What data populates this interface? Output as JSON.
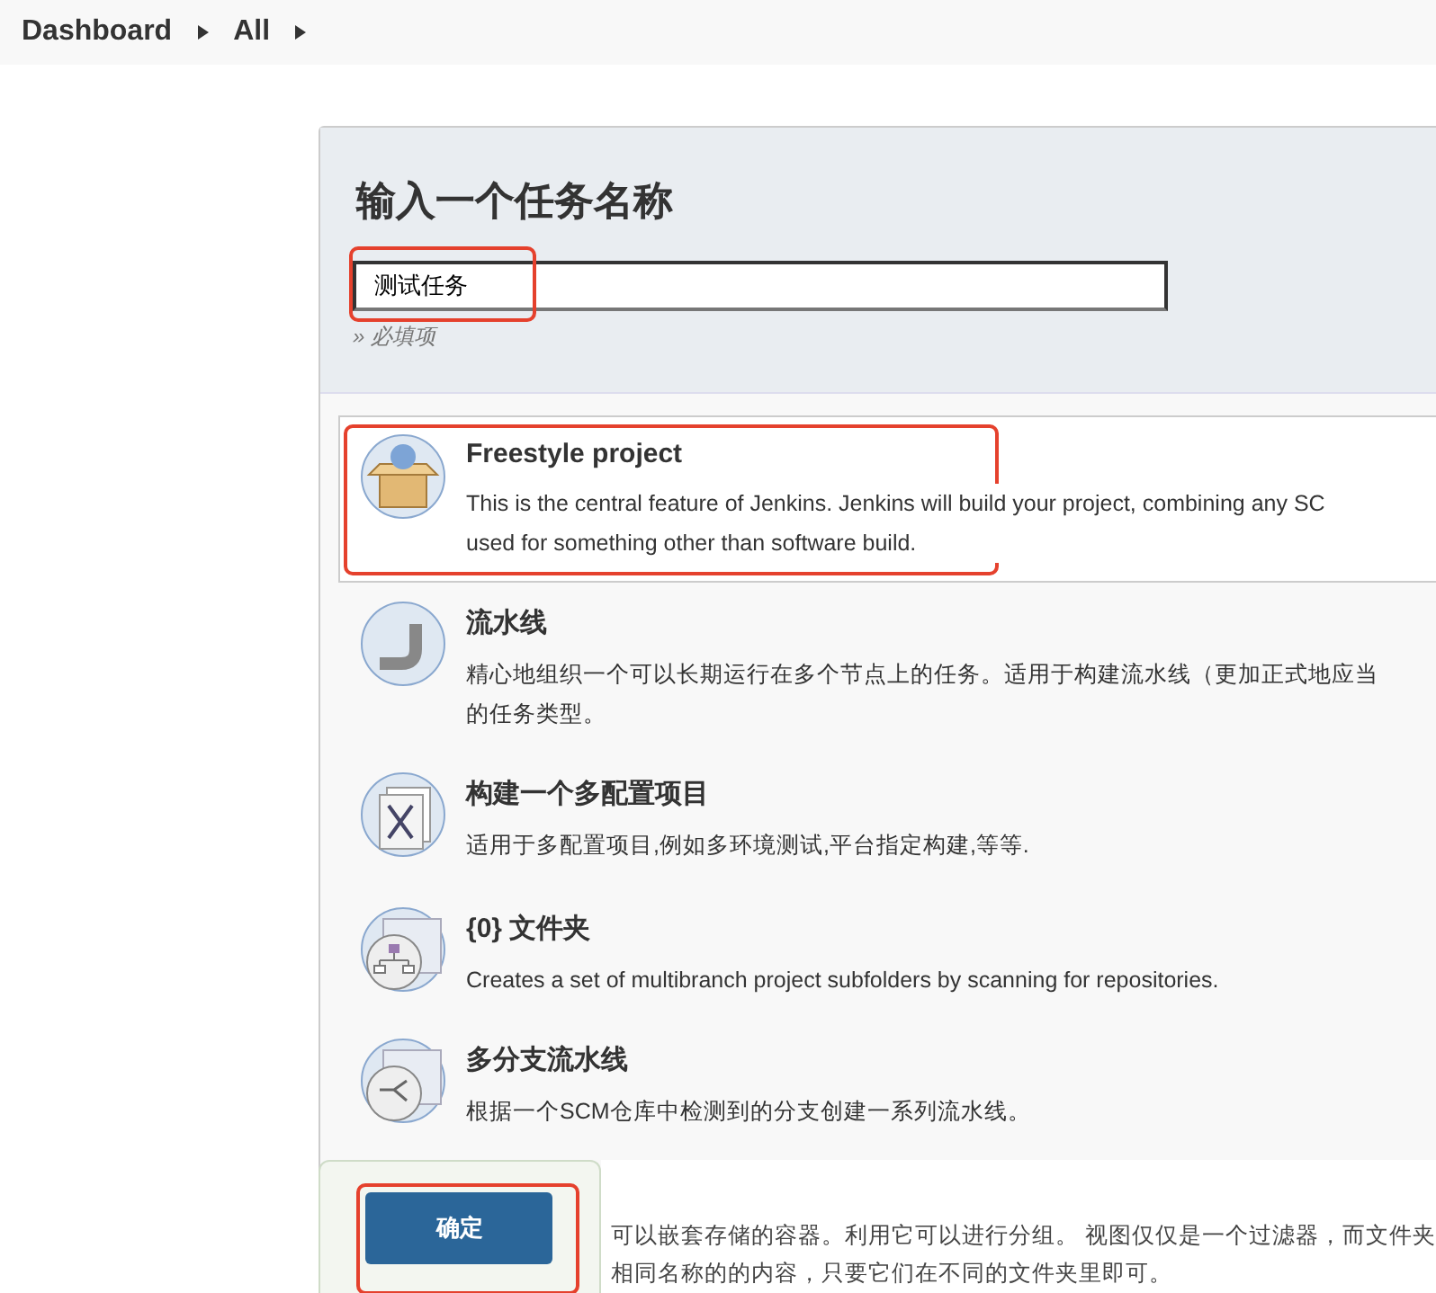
{
  "breadcrumbs": [
    {
      "label": "Dashboard"
    },
    {
      "label": "All"
    }
  ],
  "form": {
    "title": "输入一个任务名称",
    "name_field": {
      "value": "测试任务"
    },
    "hint": "» 必填项"
  },
  "item_types": [
    {
      "kind": "freestyle",
      "title": "Freestyle project",
      "selected": true,
      "description": [
        "This is the central feature of Jenkins. Jenkins will build your project, combining any SC",
        "used for something other than software build."
      ]
    },
    {
      "kind": "pipeline",
      "title": "流水线",
      "selected": false,
      "description": [
        "精心地组织一个可以长期运行在多个节点上的任务。适用于构建流水线（更加正式地应当",
        "的任务类型。"
      ]
    },
    {
      "kind": "matrix",
      "title": "构建一个多配置项目",
      "selected": false,
      "description": [
        "适用于多配置项目,例如多环境测试,平台指定构建,等等."
      ]
    },
    {
      "kind": "org-folder",
      "title": "{0} 文件夹",
      "selected": false,
      "description": [
        "Creates a set of multibranch project subfolders by scanning for repositories."
      ]
    },
    {
      "kind": "multibranch",
      "title": "多分支流水线",
      "selected": false,
      "description": [
        "根据一个SCM仓库中检测到的分支创建一系列流水线。"
      ]
    }
  ],
  "partial_item": {
    "description": [
      "可以嵌套存储的容器。利用它可以进行分组。 视图仅仅是一个过滤器，而文件夹",
      "相同名称的的内容，只要它们在不同的文件夹里即可。"
    ]
  },
  "ok_button": {
    "label": "确定"
  }
}
